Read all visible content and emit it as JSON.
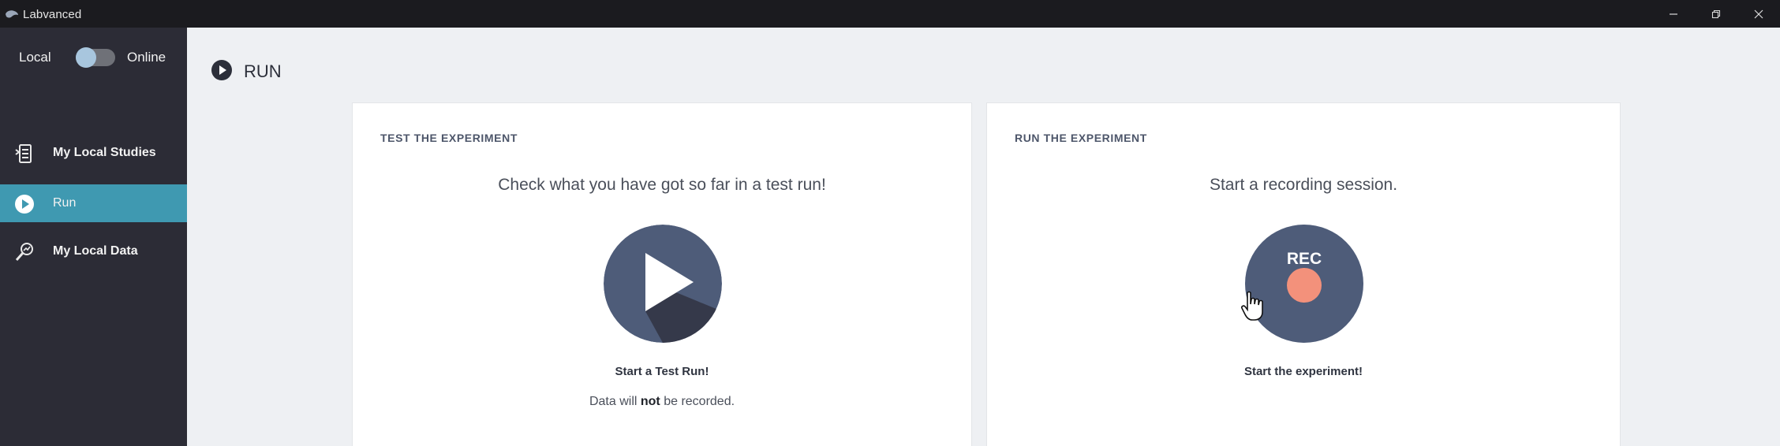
{
  "titlebar": {
    "title": "Labvanced",
    "icons": [
      "labvanced-logo-icon",
      "minimize-icon",
      "restore-icon",
      "close-icon"
    ]
  },
  "sidebar": {
    "toggle": {
      "left_label": "Local",
      "right_label": "Online",
      "state": "local"
    },
    "items": [
      {
        "label": "My Local Studies",
        "icon": "studies-icon",
        "active": false
      },
      {
        "label": "Run",
        "icon": "play-circle-icon",
        "active": true
      },
      {
        "label": "My Local Data",
        "icon": "data-magnifier-icon",
        "active": false
      }
    ]
  },
  "page": {
    "title": "RUN",
    "icon": "play-circle-icon"
  },
  "test_card": {
    "heading": "TEST THE EXPERIMENT",
    "subtitle": "Check what you have got so far in a test run!",
    "button_caption": "Start a Test Run!",
    "note_before": "Data will ",
    "note_bold": "not",
    "note_after": " be recorded."
  },
  "run_card": {
    "heading": "RUN THE EXPERIMENT",
    "subtitle": "Start a recording session.",
    "rec_label": "REC",
    "button_caption": "Start the experiment!"
  },
  "colors": {
    "sidebar_bg": "#2c2c36",
    "active_item": "#3f99b1",
    "circle_button": "#4e5c79",
    "rec_dot": "#f3917b",
    "page_bg": "#eef0f3"
  }
}
